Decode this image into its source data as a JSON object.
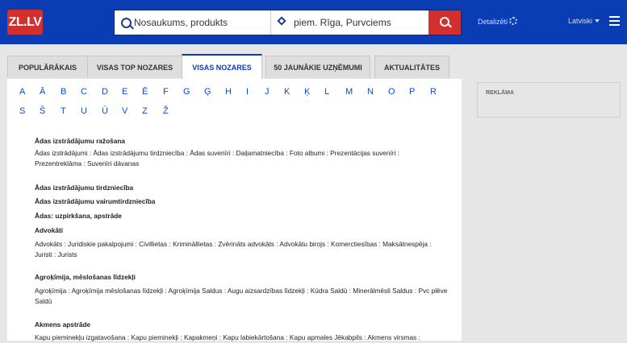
{
  "header": {
    "logo": "ZL.LV",
    "search_placeholder": "Nosaukums, produkts",
    "location_value": "piem. Rīga, Purvciems",
    "detalizeti": "Detalizēti",
    "language": "Latviski"
  },
  "tabs": [
    {
      "label": "POPULĀRĀKAIS"
    },
    {
      "label": "VISAS TOP NOZARES"
    },
    {
      "label": "VISAS NOZARES",
      "active": true
    },
    {
      "label": "50 JAUNĀKIE UZŅĒMUMI"
    },
    {
      "label": "AKTUALITĀTES"
    }
  ],
  "letters_row1": [
    "A",
    "Ā",
    "B",
    "C",
    "D",
    "E",
    "Ē",
    "F",
    "G",
    "Ģ",
    "H",
    "I",
    "J",
    "K",
    "Ķ",
    "L",
    "M",
    "N",
    "O",
    "P",
    "R"
  ],
  "letters_row2": [
    "S",
    "Š",
    "T",
    "U",
    "Ū",
    "V",
    "Z",
    "Ž"
  ],
  "categories": [
    {
      "title": "Ādas izstrādājumu ražošana",
      "items_line1": "Ādas izstrādājumi : Ādas izstrādājumu tirdzniecība : Ādas suvenīri : Daiļamatniecība : Foto albumi : Prezentācijas suvenīri :",
      "items_line2": "Prezentreklāma : Suvenīri dāvanas"
    },
    {
      "title": "Ādas izstrādājumu tirdzniecība"
    },
    {
      "title": "Ādas izstrādājumu vairumtirdzniecība"
    },
    {
      "title": "Ādas: uzpirkšana, apstrāde"
    },
    {
      "title": "Advokāti",
      "items_line1": "Advokāts : Juridiskie pakalpojumi : Civillietas : Krimināllietas : Zvērināts advokāts : Advokātu birojs : Komerctiesības : Maksātnespēja :",
      "items_line2": "Juristi : Jurists"
    },
    {
      "title": "Agroķīmija, mēslošanas līdzekļi",
      "items_line1": "Agroķīmija : Agroķīmija mēslošanas līdzekļi : Agroķīmija Saldus : Augu aizsardzības līdzekļi : Kūdra Saldū : Minerālmēsli Saldus : Pvc plēve",
      "items_line2": "Saldū"
    },
    {
      "title": "Akmens apstrāde",
      "items_line1": "Kapu pieminekļu izgatavošana : Kapu pieminekļi : Kapakmeņi : Kapu labiekārtošana : Kapu apmales Jēkabpils : Akmens virsmas :"
    }
  ],
  "sidebar": {
    "label": "REKLĀMA"
  },
  "colors": {
    "header": "#0a3cb4",
    "accent": "#d32f2f",
    "link": "#0a4adc"
  }
}
